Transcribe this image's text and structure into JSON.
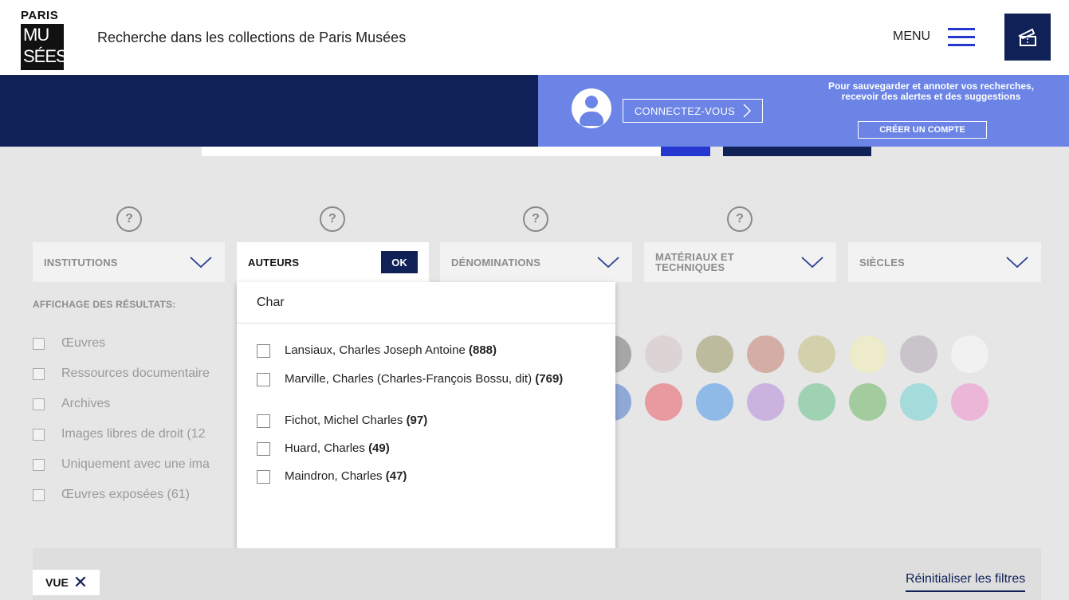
{
  "header": {
    "logo_top": "PARIS",
    "logo_line1": "MU",
    "logo_line2": "SÉES",
    "site_title": "Recherche dans les collections de Paris Musées",
    "menu_label": "MENU",
    "ticket_icon": "ticket-icon"
  },
  "banner": {
    "connect_label": "CONNECTEZ-VOUS",
    "promo_text": "Pour sauvegarder et annoter vos recherches, recevoir des alertes et des suggestions",
    "create_account_label": "CRÉER UN COMPTE"
  },
  "help_label": "?",
  "filters": {
    "institutions": "INSTITUTIONS",
    "auteurs": "AUTEURS",
    "ok": "OK",
    "denominations": "DÉNOMINATIONS",
    "materiaux": "MATÉRIAUX ET TECHNIQUES",
    "siecles": "SIÈCLES"
  },
  "display": {
    "title": "AFFICHAGE DES RÉSULTATS:",
    "options": [
      "Œuvres",
      "Ressources documentaire",
      "Archives",
      "Images libres de droit (12",
      "Uniquement avec une ima",
      "Œuvres exposées (61)"
    ]
  },
  "colors": {
    "row1": [
      "#a6a6a6",
      "#dcd3d4",
      "#bdbb9e",
      "#d4ada5",
      "#d3d1ab",
      "#edebc9",
      "#c9c4c9",
      "#f1f1f1"
    ],
    "row2": [
      "#8fa8d6",
      "#e89aa0",
      "#8fb9e6",
      "#cbb3e0",
      "#9fd2b2",
      "#a3cc9e",
      "#a6dbdb",
      "#ecb6d9"
    ]
  },
  "authors_dropdown": {
    "query": "Char",
    "items": [
      {
        "name": "Lansiaux, Charles Joseph Antoine",
        "count": "(888)"
      },
      {
        "name": "Marville, Charles (Charles-François Bossu, dit)",
        "count": "(769)"
      },
      {
        "name": "Fichot, Michel Charles",
        "count": "(97)"
      },
      {
        "name": "Huard, Charles",
        "count": "(49)"
      },
      {
        "name": "Maindron, Charles",
        "count": "(47)"
      }
    ]
  },
  "footer": {
    "vue_label": "VUE",
    "vue_close": "✕",
    "reset_label": "Réinitialiser les filtres"
  }
}
